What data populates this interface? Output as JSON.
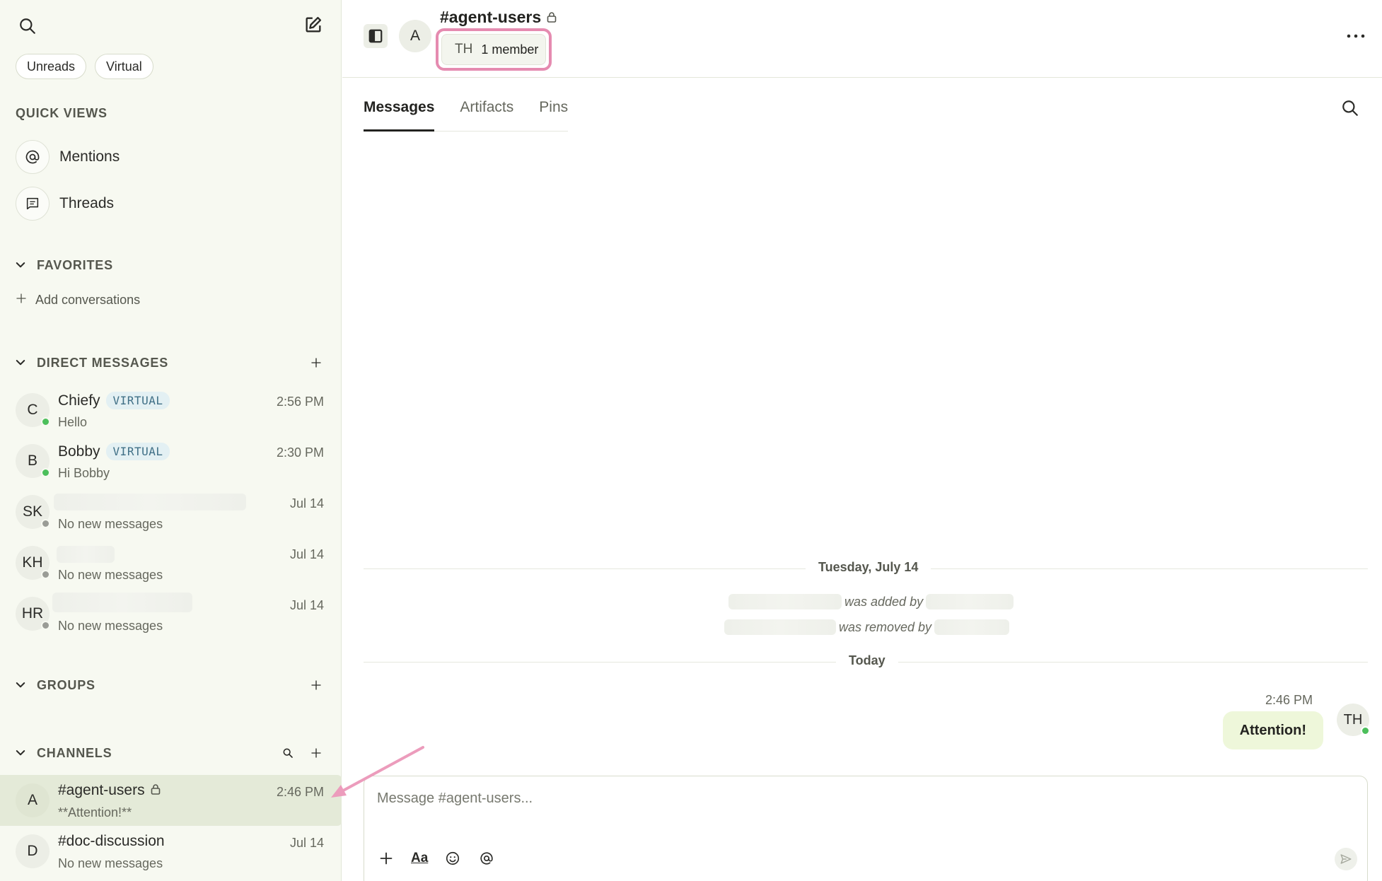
{
  "sidebar": {
    "filters": [
      "Unreads",
      "Virtual"
    ],
    "quick_views": {
      "title": "QUICK VIEWS",
      "items": [
        {
          "label": "Mentions",
          "icon": "at-icon"
        },
        {
          "label": "Threads",
          "icon": "threads-icon"
        }
      ]
    },
    "favorites": {
      "title": "FAVORITES",
      "add_label": "Add conversations"
    },
    "direct_messages": {
      "title": "DIRECT MESSAGES",
      "items": [
        {
          "initials": "C",
          "name": "Chiefy",
          "badge": "VIRTUAL",
          "preview": "Hello",
          "time": "2:56 PM",
          "status": "online"
        },
        {
          "initials": "B",
          "name": "Bobby",
          "badge": "VIRTUAL",
          "preview": "Hi Bobby",
          "time": "2:30 PM",
          "status": "online"
        },
        {
          "initials": "SK",
          "name": "",
          "badge": "",
          "preview": "No new messages",
          "time": "Jul 14",
          "status": "offline"
        },
        {
          "initials": "KH",
          "name": "",
          "badge": "",
          "preview": "No new messages",
          "time": "Jul 14",
          "status": "offline"
        },
        {
          "initials": "HR",
          "name": "",
          "badge": "",
          "preview": "No new messages",
          "time": "Jul 14",
          "status": "offline"
        }
      ]
    },
    "groups": {
      "title": "GROUPS"
    },
    "channels": {
      "title": "CHANNELS",
      "items": [
        {
          "initials": "A",
          "name": "#agent-users",
          "preview": "**Attention!**",
          "time": "2:46 PM"
        },
        {
          "initials": "D",
          "name": "#doc-discussion",
          "preview": "No new messages",
          "time": "Jul 14"
        }
      ]
    }
  },
  "header": {
    "avatar": "A",
    "title": "#agent-users",
    "member_initials": "TH",
    "member_count": "1 member"
  },
  "tabs": [
    "Messages",
    "Artifacts",
    "Pins"
  ],
  "timeline": {
    "date_1": "Tuesday, July 14",
    "sys_1": "was added by",
    "sys_2": "was removed by",
    "date_2": "Today",
    "message": {
      "time": "2:46 PM",
      "text": "Attention!",
      "avatar": "TH"
    }
  },
  "composer": {
    "placeholder": "Message #agent-users...",
    "format_label": "Aa"
  },
  "colors": {
    "accent_highlight": "#e58bb0",
    "online": "#4cbf5b",
    "sidebar_bg": "#f7f9f1",
    "active_row": "#e4ead8",
    "bubble": "#eef7da"
  }
}
